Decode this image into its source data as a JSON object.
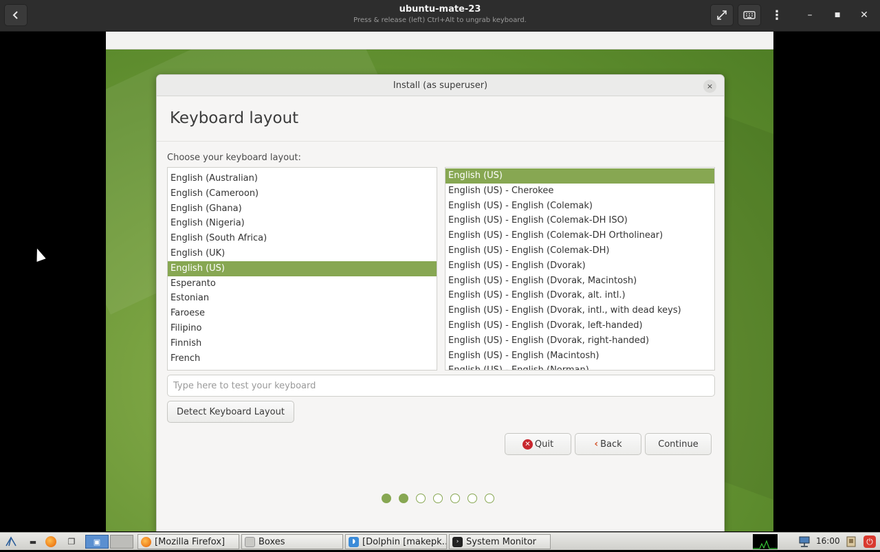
{
  "header": {
    "title": "ubuntu-mate-23",
    "subtitle": "Press & release (left) Ctrl+Alt to ungrab keyboard."
  },
  "dialog": {
    "title": "Install (as superuser)",
    "close_glyph": "×",
    "page_title": "Keyboard layout",
    "choose_label": "Choose your keyboard layout:",
    "layouts": [
      "English (Australian)",
      "English (Cameroon)",
      "English (Ghana)",
      "English (Nigeria)",
      "English (South Africa)",
      "English (UK)",
      "English (US)",
      "Esperanto",
      "Estonian",
      "Faroese",
      "Filipino",
      "Finnish",
      "French"
    ],
    "selected_layout_index": 6,
    "variants": [
      "English (US)",
      "English (US) - Cherokee",
      "English (US) - English (Colemak)",
      "English (US) - English (Colemak-DH ISO)",
      "English (US) - English (Colemak-DH Ortholinear)",
      "English (US) - English (Colemak-DH)",
      "English (US) - English (Dvorak)",
      "English (US) - English (Dvorak, Macintosh)",
      "English (US) - English (Dvorak, alt. intl.)",
      "English (US) - English (Dvorak, intl., with dead keys)",
      "English (US) - English (Dvorak, left-handed)",
      "English (US) - English (Dvorak, right-handed)",
      "English (US) - English (Macintosh)",
      "English (US) - English (Norman)"
    ],
    "selected_variant_index": 0,
    "test_placeholder": "Type here to test your keyboard",
    "detect_label": "Detect Keyboard Layout",
    "quit_label": "Quit",
    "back_label": "Back",
    "continue_label": "Continue",
    "progress": {
      "total_steps": 7,
      "completed_steps": 2
    },
    "accent_color": "#87a752"
  },
  "taskbar": {
    "windows": [
      "[Mozilla Firefox]",
      "Boxes",
      "[Dolphin [makepk…",
      "System Monitor"
    ],
    "clock": "16:00"
  }
}
